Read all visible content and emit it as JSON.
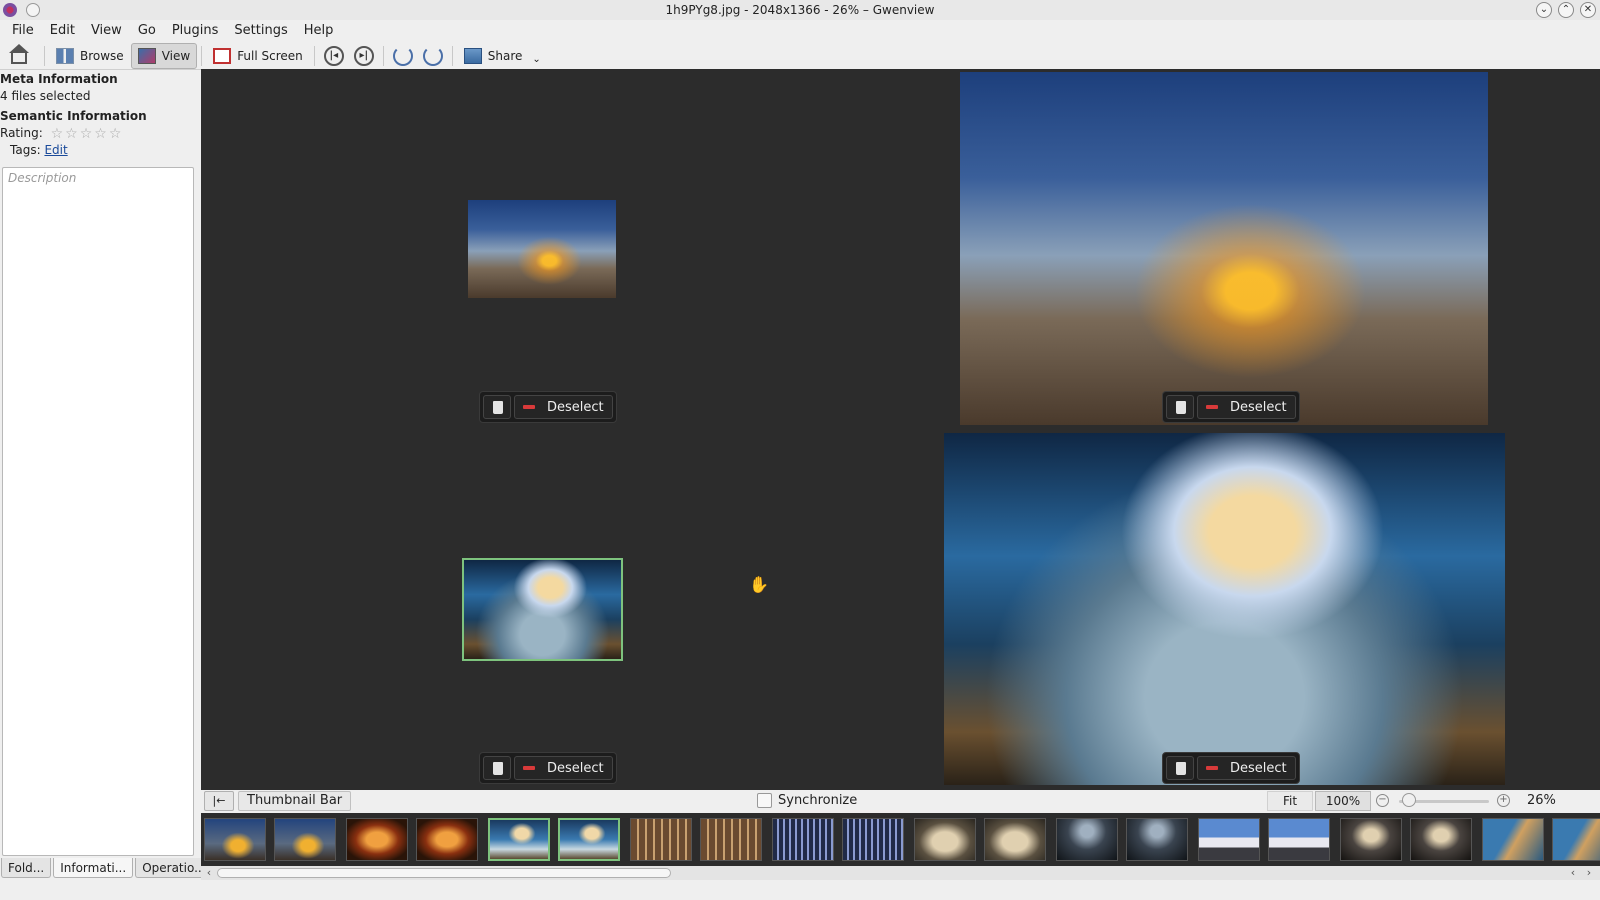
{
  "window": {
    "title": "1h9PYg8.jpg - 2048x1366 - 26% – Gwenview"
  },
  "menubar": {
    "items": [
      "File",
      "Edit",
      "View",
      "Go",
      "Plugins",
      "Settings",
      "Help"
    ]
  },
  "toolbar": {
    "browse_label": "Browse",
    "view_label": "View",
    "fullscreen_label": "Full Screen",
    "share_label": "Share"
  },
  "sidebar": {
    "meta_heading": "Meta Information",
    "files_selected": "4 files selected",
    "semantic_heading": "Semantic Information",
    "rating_label": "Rating:",
    "rating_value": 0,
    "rating_max": 5,
    "tags_label": "Tags:",
    "tags_edit_link": "Edit",
    "description_placeholder": "Description"
  },
  "side_tabs": [
    "Fold...",
    "Informati...",
    "Operatio..."
  ],
  "viewer": {
    "deselect_label": "Deselect"
  },
  "thumbnail_bar": {
    "toggle_label": "Thumbnail Bar",
    "synchronize_label": "Synchronize",
    "synchronize_checked": false,
    "zoom_fit_label": "Fit",
    "zoom_100_label": "100%",
    "zoom_value": "26%",
    "thumbnails": [
      {
        "kind": "city",
        "selected": false
      },
      {
        "kind": "city",
        "selected": false
      },
      {
        "kind": "arch",
        "selected": false
      },
      {
        "kind": "arch",
        "selected": false
      },
      {
        "kind": "ice",
        "selected": true
      },
      {
        "kind": "ice",
        "selected": true
      },
      {
        "kind": "build",
        "selected": false
      },
      {
        "kind": "build",
        "selected": false
      },
      {
        "kind": "forest",
        "selected": false
      },
      {
        "kind": "forest",
        "selected": false
      },
      {
        "kind": "sand",
        "selected": false
      },
      {
        "kind": "sand",
        "selected": false
      },
      {
        "kind": "dark",
        "selected": false
      },
      {
        "kind": "dark",
        "selected": false
      },
      {
        "kind": "house",
        "selected": false
      },
      {
        "kind": "house",
        "selected": false
      },
      {
        "kind": "cave",
        "selected": false
      },
      {
        "kind": "cave",
        "selected": false
      },
      {
        "kind": "coast",
        "selected": false
      },
      {
        "kind": "coast",
        "selected": false
      }
    ]
  },
  "colors": {
    "viewer_bg": "#2c2c2c",
    "selection_accent": "#7ec37e",
    "deselect_minus": "#d83a3a",
    "link": "#1a4a9a"
  }
}
